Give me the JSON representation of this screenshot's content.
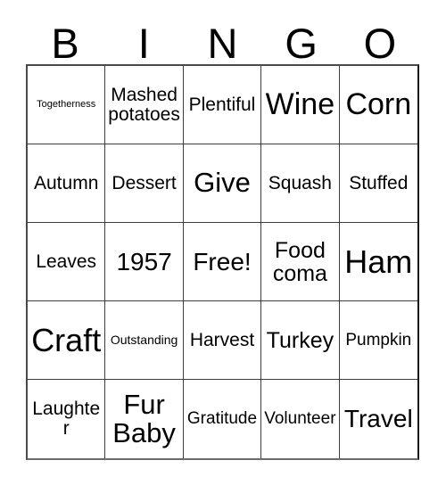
{
  "card": {
    "title_letters": [
      "B",
      "I",
      "N",
      "G",
      "O"
    ],
    "colors": {
      "background": "#ffffff",
      "text": "#000000",
      "grid_line": "#3c3c3c",
      "grid_border": "#1a1a1a"
    },
    "grid": {
      "columns": 5,
      "rows": 5,
      "cells": [
        {
          "text": "Togetherness",
          "size": "fs-xxs"
        },
        {
          "text": "Mashed potatoes",
          "size": "fs-md"
        },
        {
          "text": "Plentiful",
          "size": "fs-md"
        },
        {
          "text": "Wine",
          "size": "fs-huge"
        },
        {
          "text": "Corn",
          "size": "fs-huge"
        },
        {
          "text": "Autumn",
          "size": "fs-md"
        },
        {
          "text": "Dessert",
          "size": "fs-md"
        },
        {
          "text": "Give",
          "size": "fs-xxl"
        },
        {
          "text": "Squash",
          "size": "fs-md"
        },
        {
          "text": "Stuffed",
          "size": "fs-md"
        },
        {
          "text": "Leaves",
          "size": "fs-md"
        },
        {
          "text": "1957",
          "size": "fs-xl"
        },
        {
          "text": "Free!",
          "size": "fs-xl"
        },
        {
          "text": "Food coma",
          "size": "fs-lg"
        },
        {
          "text": "Ham",
          "size": "fs-mega"
        },
        {
          "text": "Craft",
          "size": "fs-mega"
        },
        {
          "text": "Outstanding",
          "size": "fs-xs"
        },
        {
          "text": "Harvest",
          "size": "fs-md"
        },
        {
          "text": "Turkey",
          "size": "fs-lg"
        },
        {
          "text": "Pumpkin",
          "size": "fs-sm"
        },
        {
          "text": "Laughter",
          "size": "fs-md"
        },
        {
          "text": "Fur Baby",
          "size": "fs-xxl"
        },
        {
          "text": "Gratitude",
          "size": "fs-sm"
        },
        {
          "text": "Volunteer",
          "size": "fs-sm"
        },
        {
          "text": "Travel",
          "size": "fs-xl"
        }
      ]
    }
  }
}
